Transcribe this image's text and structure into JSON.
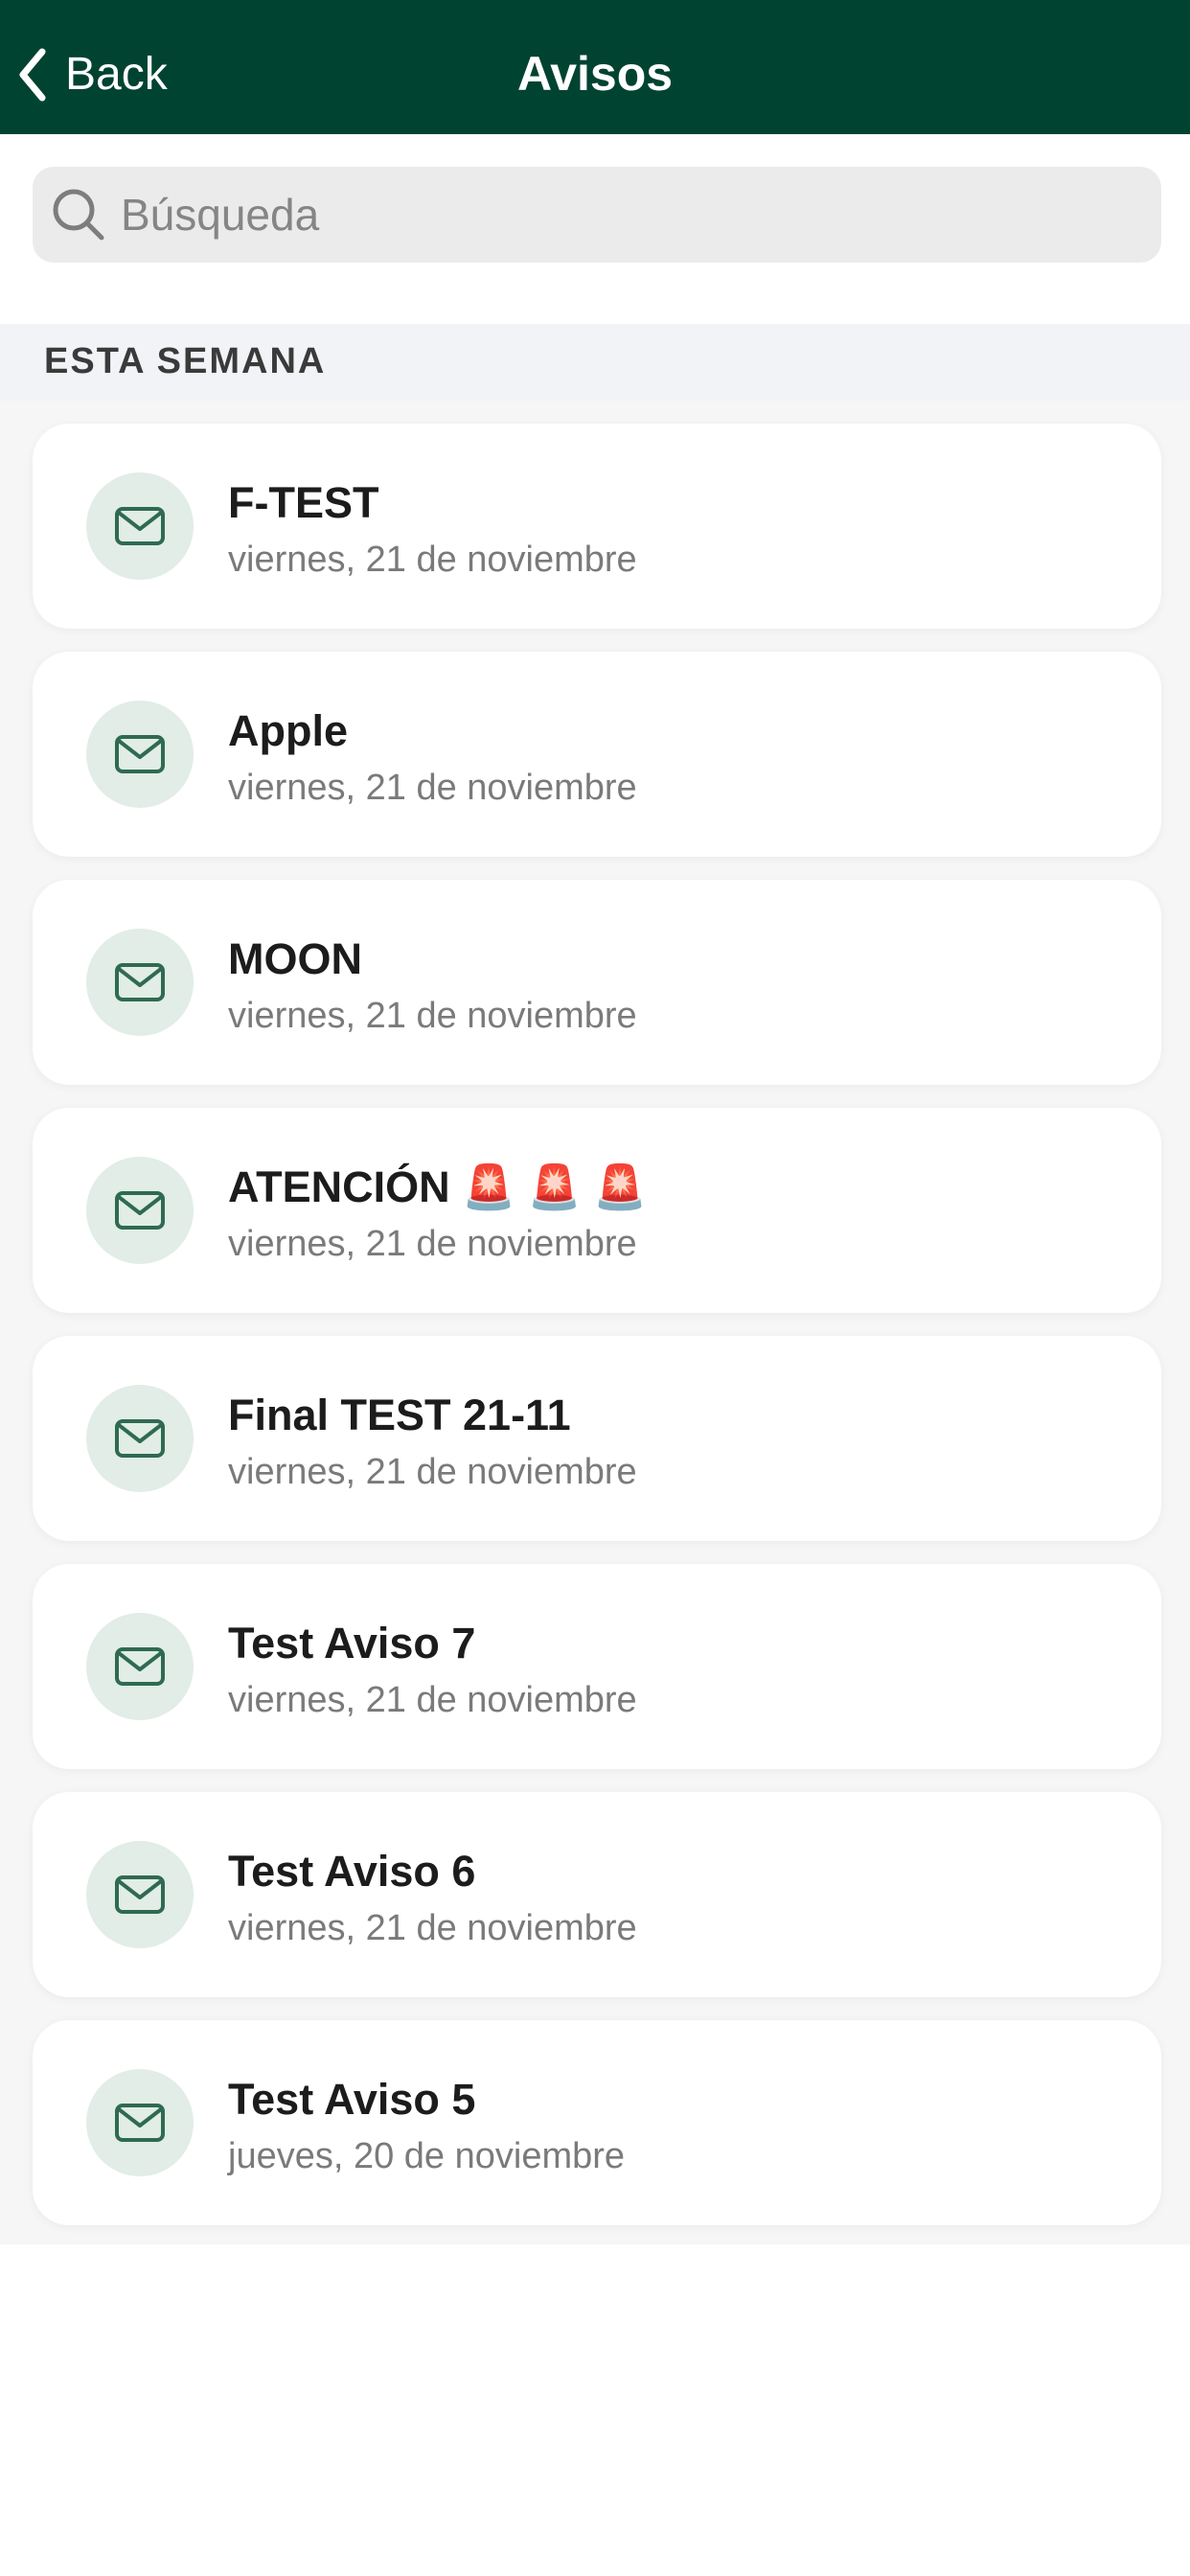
{
  "header": {
    "back_label": "Back",
    "title": "Avisos"
  },
  "search": {
    "placeholder": "Búsqueda",
    "value": ""
  },
  "section": {
    "label": "ESTA SEMANA"
  },
  "notices": [
    {
      "title": "F-TEST",
      "date": "viernes, 21 de noviembre"
    },
    {
      "title": "Apple",
      "date": "viernes, 21 de noviembre"
    },
    {
      "title": "MOON",
      "date": "viernes, 21 de noviembre"
    },
    {
      "title": "ATENCIÓN 🚨 🚨 🚨",
      "date": "viernes, 21 de noviembre"
    },
    {
      "title": "Final TEST 21-11",
      "date": "viernes, 21 de noviembre"
    },
    {
      "title": "Test Aviso 7",
      "date": "viernes, 21 de noviembre"
    },
    {
      "title": "Test Aviso 6",
      "date": "viernes, 21 de noviembre"
    },
    {
      "title": "Test Aviso 5",
      "date": "jueves, 20 de noviembre"
    }
  ],
  "colors": {
    "header_bg": "#014331",
    "icon_bg": "#e1ede6",
    "icon_stroke": "#2f6a52"
  },
  "icons": {
    "back": "chevron-left-icon",
    "search": "search-icon",
    "notice": "envelope-icon"
  }
}
